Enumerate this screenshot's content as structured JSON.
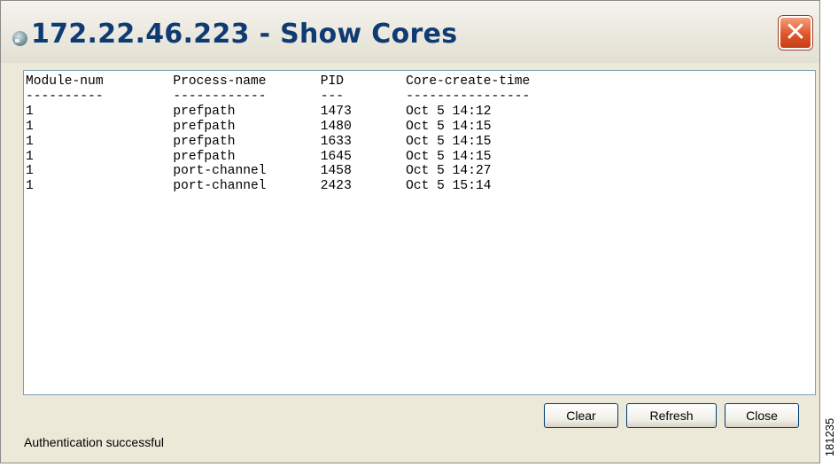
{
  "window": {
    "title": "172.22.46.223 - Show Cores",
    "close_glyph": "✕"
  },
  "output": {
    "columns": [
      "Module-num",
      "Process-name",
      "PID",
      "Core-create-time"
    ],
    "separators": [
      "----------",
      "------------",
      "---",
      "----------------"
    ],
    "rows": [
      [
        "1",
        "prefpath",
        "1473",
        "Oct 5 14:12"
      ],
      [
        "1",
        "prefpath",
        "1480",
        "Oct 5 14:15"
      ],
      [
        "1",
        "prefpath",
        "1633",
        "Oct 5 14:15"
      ],
      [
        "1",
        "prefpath",
        "1645",
        "Oct 5 14:15"
      ],
      [
        "1",
        "port-channel",
        "1458",
        "Oct 5 14:27"
      ],
      [
        "1",
        "port-channel",
        "2423",
        "Oct 5 15:14"
      ]
    ],
    "text": "Module-num         Process-name       PID        Core-create-time\n----------         ------------       ---        ----------------\n1                  prefpath           1473       Oct 5 14:12\n1                  prefpath           1480       Oct 5 14:15\n1                  prefpath           1633       Oct 5 14:15\n1                  prefpath           1645       Oct 5 14:15\n1                  port-channel       1458       Oct 5 14:27\n1                  port-channel       2423       Oct 5 15:14"
  },
  "buttons": {
    "clear": "Clear",
    "refresh": "Refresh",
    "close": "Close"
  },
  "status": {
    "message": "Authentication successful"
  },
  "figure_id": "181235"
}
